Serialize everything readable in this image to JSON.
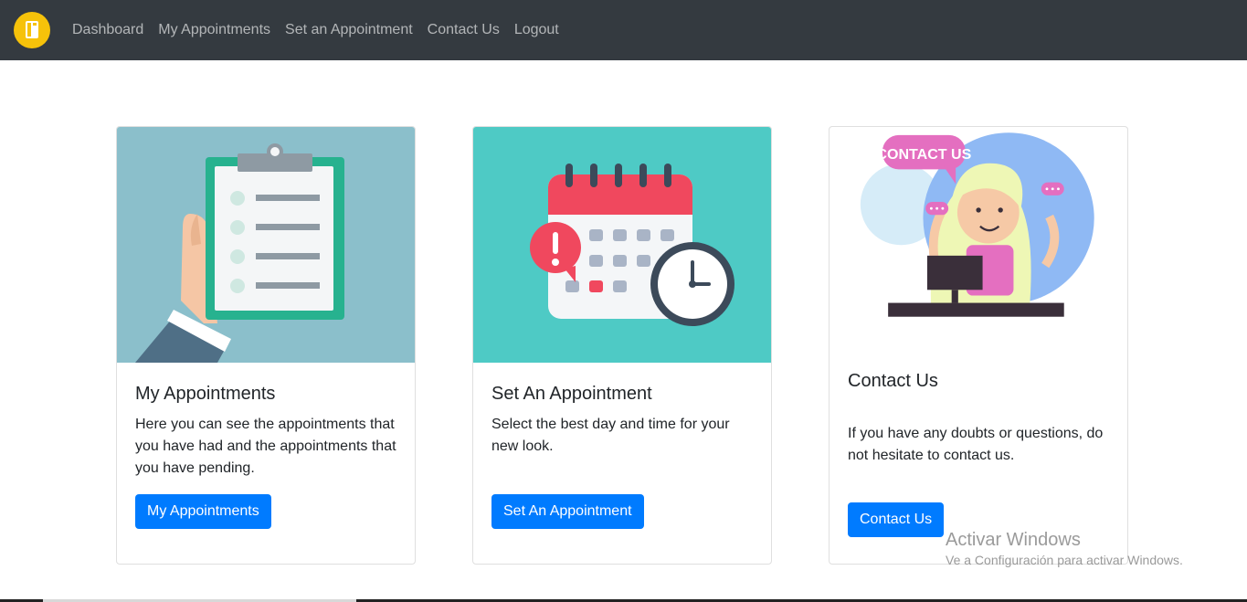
{
  "nav": {
    "logo_icon": "book-icon",
    "links": [
      "Dashboard",
      "My Appointments",
      "Set an Appointment",
      "Contact Us",
      "Logout"
    ]
  },
  "cards": [
    {
      "illustration": "clipboard-checklist-illustration",
      "title": "My Appointments",
      "text": "Here you can see the appointments that you have had and the appointments that you have pending.",
      "button": "My Appointments"
    },
    {
      "illustration": "calendar-clock-illustration",
      "title": "Set An Appointment",
      "text": "Select the best day and time for your new look.",
      "button": "Set An Appointment"
    },
    {
      "illustration": "contact-us-operator-illustration",
      "badge": "CONTACT US",
      "title": "Contact Us",
      "text": "If you have any doubts or questions, do not hesitate to contact us.",
      "button": "Contact Us"
    }
  ],
  "watermark": {
    "title": "Activar Windows",
    "subtitle": "Ve a Configuración para activar Windows."
  },
  "colors": {
    "navbar": "#343a40",
    "logo": "#f6c20a",
    "primary_button": "#007bff"
  }
}
